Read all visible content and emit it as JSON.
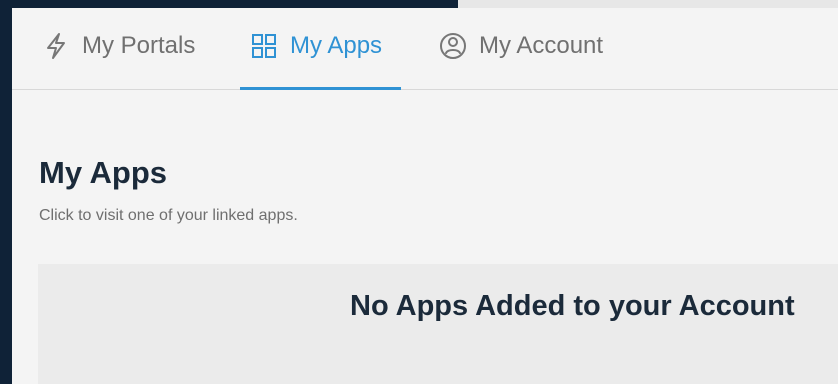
{
  "tabs": [
    {
      "label": "My Portals",
      "icon": "lightning-icon",
      "active": false
    },
    {
      "label": "My Apps",
      "icon": "grid-icon",
      "active": true
    },
    {
      "label": "My Account",
      "icon": "user-circle-icon",
      "active": false
    }
  ],
  "page": {
    "title": "My Apps",
    "subtitle": "Click to visit one of your linked apps."
  },
  "empty_state": {
    "title": "No Apps Added to your Account"
  },
  "colors": {
    "background_dark": "#0f2237",
    "panel": "#f4f4f4",
    "accent": "#2f92d4",
    "text_primary": "#1b2a3a",
    "text_secondary": "#707070",
    "empty_card": "#ebebeb"
  }
}
